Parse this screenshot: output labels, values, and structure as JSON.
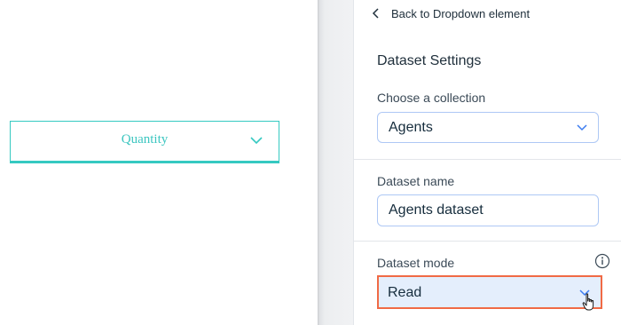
{
  "canvas": {
    "dropdown": {
      "value": "Quantity"
    }
  },
  "panel": {
    "back_label": "Back to Dropdown element",
    "title": "Dataset Settings",
    "collection": {
      "label": "Choose a collection",
      "value": "Agents"
    },
    "dataset_name": {
      "label": "Dataset name",
      "value": "Agents dataset"
    },
    "dataset_mode": {
      "label": "Dataset mode",
      "value": "Read"
    }
  },
  "colors": {
    "accent_teal": "#35c9c1",
    "field_border": "#aec8f5",
    "highlight_border": "#f06a45",
    "chevron_blue": "#3b7cf0"
  }
}
